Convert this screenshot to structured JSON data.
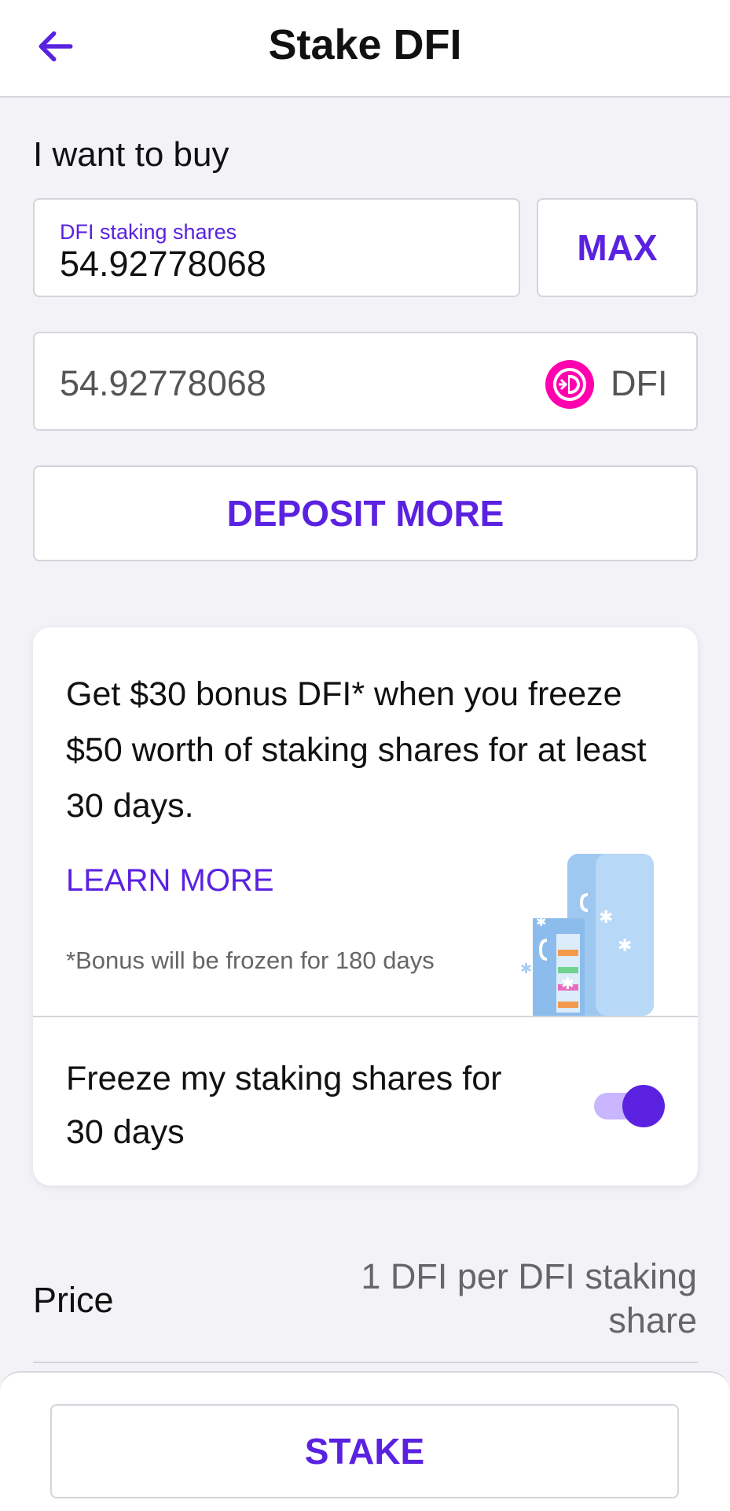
{
  "header": {
    "title": "Stake DFI",
    "back_icon": "arrow-left-icon"
  },
  "form": {
    "section_label": "I want to buy",
    "shares_field_label": "DFI staking shares",
    "shares_value": "54.92778068",
    "max_label": "MAX",
    "dfi_amount": "54.92778068",
    "dfi_icon": "defichain-logo-icon",
    "dfi_unit": "DFI",
    "deposit_label": "DEPOSIT MORE"
  },
  "promo": {
    "text": "Get $30 bonus DFI* when you freeze $50 worth of staking shares for at least 30 days.",
    "learn_more": "LEARN MORE",
    "note": "*Bonus will be frozen for 180 days",
    "illustration": "fridge-illustration",
    "freeze_label": "Freeze my staking shares for 30 days",
    "freeze_enabled": true
  },
  "price": {
    "label": "Price",
    "value": "1 DFI per DFI staking share"
  },
  "footer": {
    "stake_label": "STAKE"
  },
  "colors": {
    "accent": "#5a22e0",
    "dfi_brand": "#ff00af",
    "background": "#f2f2f7"
  }
}
